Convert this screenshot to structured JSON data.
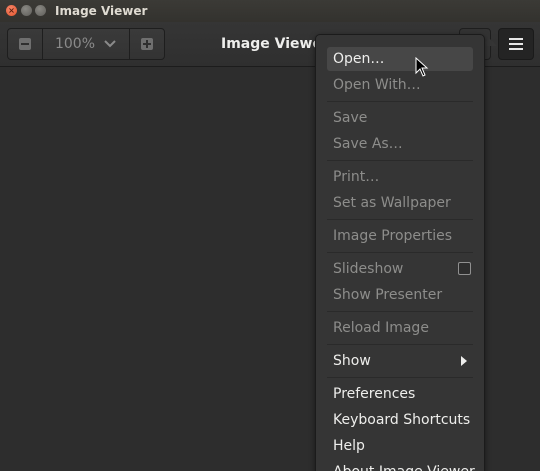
{
  "window": {
    "title": "Image Viewer"
  },
  "header": {
    "title": "Image Viewe",
    "zoom_level": "100%"
  },
  "menu": {
    "items": [
      {
        "label": "Open…",
        "enabled": true
      },
      {
        "label": "Open With…",
        "enabled": false
      },
      {
        "label": "Save",
        "enabled": false
      },
      {
        "label": "Save As…",
        "enabled": false
      },
      {
        "label": "Print…",
        "enabled": false
      },
      {
        "label": "Set as Wallpaper",
        "enabled": false
      },
      {
        "label": "Image Properties",
        "enabled": false
      },
      {
        "label": "Slideshow",
        "enabled": false
      },
      {
        "label": "Show Presenter",
        "enabled": false
      },
      {
        "label": "Reload Image",
        "enabled": false
      },
      {
        "label": "Show",
        "enabled": true
      },
      {
        "label": "Preferences",
        "enabled": true
      },
      {
        "label": "Keyboard Shortcuts",
        "enabled": true
      },
      {
        "label": "Help",
        "enabled": true
      },
      {
        "label": "About Image Viewer",
        "enabled": true
      }
    ]
  },
  "icons": {
    "close": "close-icon",
    "minimize": "minimize-icon",
    "maximize": "maximize-icon",
    "zoom_out": "zoom-out-icon",
    "zoom_in": "zoom-in-icon",
    "zoom_dropdown": "chevron-down-icon",
    "menu": "hamburger-menu-icon",
    "submenu": "chevron-right-icon",
    "cursor": "mouse-pointer-icon"
  },
  "colors": {
    "background": "#2d2d2d",
    "popover": "#353535",
    "text": "#eeeeec",
    "text_disabled": "#8d8d8b",
    "close_button": "#e2542b"
  }
}
